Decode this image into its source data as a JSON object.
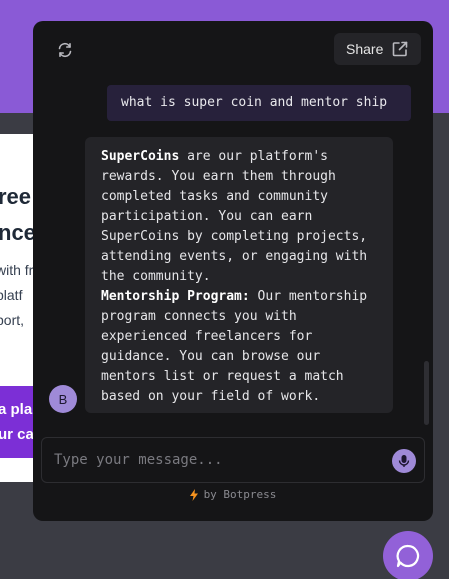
{
  "background_page": {
    "heading_line1": "ree",
    "heading_line2": "nce",
    "text_line1": "with fr",
    "text_line2": " platf",
    "text_line3": "port, ",
    "cta_line1": "a pla",
    "cta_line2": "ur ca"
  },
  "header": {
    "refresh_icon": "refresh-icon",
    "share_label": "Share",
    "share_icon": "external-link-icon"
  },
  "messages": {
    "user": "what is super coin and mentor ship",
    "bot_avatar_initial": "B",
    "bot_para1_title": "SuperCoins",
    "bot_para1_body": " are our platform's\nrewards. You earn them through\ncompleted tasks and community\nparticipation. You can earn\nSuperCoins by completing projects,\nattending events, or engaging with\nthe community.",
    "bot_para2_title": "Mentorship Program:",
    "bot_para2_body": " Our mentorship\nprogram connects you with\nexperienced freelancers for\nguidance. You can browse our\nmentors list or request a match\nbased on your field of work."
  },
  "composer": {
    "placeholder": "Type your message...",
    "mic_icon": "microphone-icon"
  },
  "footer": {
    "powered_by": "by Botpress",
    "bolt_icon": "bolt-icon"
  },
  "colors": {
    "accent": "#9f8ad8",
    "launcher": "#9261d8",
    "user_bubble": "#27213b",
    "bot_bubble": "#242428",
    "background_purple": "#8a5ad6"
  }
}
